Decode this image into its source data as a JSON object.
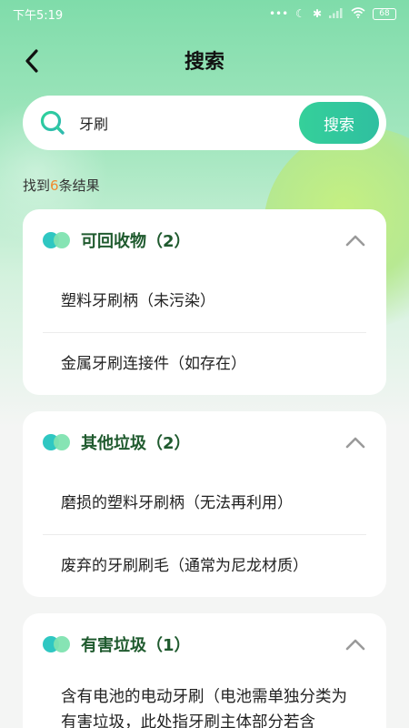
{
  "status_bar": {
    "time": "下午5:19",
    "battery": "68",
    "icons": [
      "more-dots-icon",
      "moon-icon",
      "bluetooth-icon",
      "signal-icon",
      "wifi-icon",
      "battery-icon"
    ]
  },
  "header": {
    "title": "搜索"
  },
  "search": {
    "value": "牙刷",
    "button_label": "搜索"
  },
  "summary": {
    "prefix": "找到",
    "count": "6",
    "suffix": "条结果"
  },
  "colors": {
    "accent": "#2fc7a0",
    "count": "#f08a2c",
    "category_title": "#1f5a2e"
  },
  "categories": [
    {
      "title": "可回收物（2）",
      "items": [
        "塑料牙刷柄（未污染）",
        "金属牙刷连接件（如存在）"
      ]
    },
    {
      "title": "其他垃圾（2）",
      "items": [
        "磨损的塑料牙刷柄（无法再利用）",
        "废弃的牙刷刷毛（通常为尼龙材质）"
      ]
    },
    {
      "title": "有害垃圾（1）",
      "items": [
        "含有电池的电动牙刷（电池需单独分类为有害垃圾，此处指牙刷主体部分若含"
      ]
    }
  ]
}
